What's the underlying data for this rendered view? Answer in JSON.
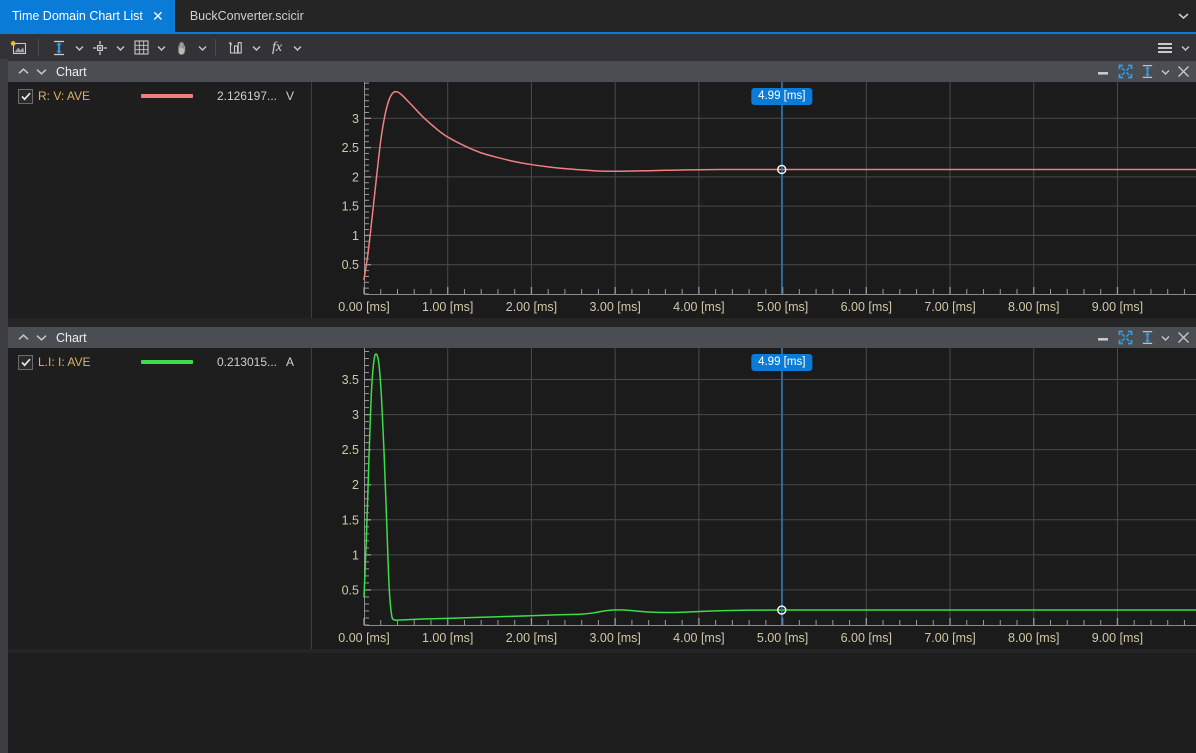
{
  "window": {
    "tabs": [
      {
        "label": "Time Domain Chart List",
        "active": true,
        "closable": true
      },
      {
        "label": "BuckConverter.scicir",
        "active": false,
        "closable": false
      }
    ],
    "tab_overflow_icon": "chevron-down-icon"
  },
  "toolbar": {
    "groups": [
      {
        "items": [
          {
            "icon": "new-chart-icon",
            "caret": false
          }
        ]
      },
      {
        "items": [
          {
            "icon": "vertical-zoom-icon",
            "caret": true
          },
          {
            "icon": "crosshair-cursor-icon",
            "caret": true
          },
          {
            "icon": "grid-icon",
            "caret": true
          },
          {
            "icon": "pan-hand-icon",
            "caret": true
          }
        ]
      },
      {
        "items": [
          {
            "icon": "bar-chart-icon",
            "caret": true
          },
          {
            "icon": "fx-function-icon",
            "caret": true,
            "label": "fx"
          }
        ]
      }
    ],
    "menu_icon": "hamburger-menu-icon",
    "menu_caret_icon": "chevron-down-icon"
  },
  "panels": [
    {
      "title": "Chart",
      "controls": {
        "collapse_up_icon": "chevron-up-icon",
        "collapse_down_icon": "chevron-down-icon",
        "minimize_icon": "minimize-icon",
        "maximize_icon": "maximize-icon",
        "fit_vertical_icon": "fit-vertical-icon",
        "fit_caret_icon": "chevron-down-icon",
        "close_icon": "close-icon"
      },
      "legend": [
        {
          "checked": true,
          "name": "R: V: AVE",
          "color": "#f08080",
          "value": "2.126197...",
          "unit": "V"
        }
      ],
      "cursor": {
        "label": "4.99 [ms]",
        "x_value": 4.99,
        "y_value": 2.126197
      }
    },
    {
      "title": "Chart",
      "controls": {
        "collapse_up_icon": "chevron-up-icon",
        "collapse_down_icon": "chevron-down-icon",
        "minimize_icon": "minimize-icon",
        "maximize_icon": "maximize-icon",
        "fit_vertical_icon": "fit-vertical-icon",
        "fit_caret_icon": "chevron-down-icon",
        "close_icon": "close-icon"
      },
      "legend": [
        {
          "checked": true,
          "name": "L.I: I: AVE",
          "color": "#3ddc4a",
          "value": "0.213015...",
          "unit": "A"
        }
      ],
      "cursor": {
        "label": "4.99 [ms]",
        "x_value": 4.99,
        "y_value": 0.213015
      }
    }
  ],
  "colors": {
    "accent": "#0a7bd6",
    "panel_header": "#4a4d52",
    "plot_background": "#1b1b1b",
    "grid": "#4a4a4a",
    "tick_label": "#d0c8a8",
    "series_1": "#f08080",
    "series_2": "#3ddc4a"
  },
  "chart_data": [
    {
      "type": "line",
      "title": "Chart",
      "xlabel": "",
      "ylabel": "",
      "grid": true,
      "legend_position": "left-pane",
      "xlim": [
        0.0,
        9.95
      ],
      "ylim": [
        0.0,
        3.62
      ],
      "xticks": [
        0.0,
        1.0,
        2.0,
        3.0,
        4.0,
        5.0,
        6.0,
        7.0,
        8.0,
        9.0
      ],
      "xticklabels": [
        "0.00 [ms]",
        "1.00 [ms]",
        "2.00 [ms]",
        "3.00 [ms]",
        "4.00 [ms]",
        "5.00 [ms]",
        "6.00 [ms]",
        "7.00 [ms]",
        "8.00 [ms]",
        "9.00 [ms]"
      ],
      "yticks": [
        0.5,
        1.0,
        1.5,
        2.0,
        2.5,
        3.0
      ],
      "yticklabels": [
        "0.5",
        "1",
        "1.5",
        "2",
        "2.5",
        "3"
      ],
      "series": [
        {
          "name": "R: V: AVE",
          "color": "#f08080",
          "unit": "V",
          "x": [
            0.0,
            0.05,
            0.1,
            0.15,
            0.2,
            0.25,
            0.3,
            0.35,
            0.4,
            0.45,
            0.5,
            0.6,
            0.7,
            0.8,
            0.9,
            1.0,
            1.2,
            1.4,
            1.6,
            1.8,
            2.0,
            2.2,
            2.4,
            2.6,
            2.8,
            3.0,
            3.2,
            3.4,
            3.6,
            3.8,
            4.0,
            4.4,
            4.8,
            5.2,
            5.6,
            6.0,
            7.0,
            8.0,
            9.0,
            9.95
          ],
          "y": [
            0.25,
            0.72,
            1.35,
            2.0,
            2.62,
            3.05,
            3.32,
            3.44,
            3.45,
            3.4,
            3.33,
            3.18,
            3.03,
            2.9,
            2.78,
            2.68,
            2.53,
            2.41,
            2.33,
            2.26,
            2.21,
            2.17,
            2.14,
            2.12,
            2.1,
            2.095,
            2.1,
            2.105,
            2.112,
            2.118,
            2.122,
            2.126,
            2.127,
            2.126,
            2.126,
            2.126,
            2.126,
            2.126,
            2.126,
            2.126
          ]
        }
      ]
    },
    {
      "type": "line",
      "title": "Chart",
      "xlabel": "",
      "ylabel": "",
      "grid": true,
      "legend_position": "left-pane",
      "xlim": [
        0.0,
        9.95
      ],
      "ylim": [
        0.0,
        3.95
      ],
      "xticks": [
        0.0,
        1.0,
        2.0,
        3.0,
        4.0,
        5.0,
        6.0,
        7.0,
        8.0,
        9.0
      ],
      "xticklabels": [
        "0.00 [ms]",
        "1.00 [ms]",
        "2.00 [ms]",
        "3.00 [ms]",
        "4.00 [ms]",
        "5.00 [ms]",
        "6.00 [ms]",
        "7.00 [ms]",
        "8.00 [ms]",
        "9.00 [ms]"
      ],
      "yticks": [
        0.5,
        1.0,
        1.5,
        2.0,
        2.5,
        3.0,
        3.5
      ],
      "yticklabels": [
        "0.5",
        "1",
        "1.5",
        "2",
        "2.5",
        "3",
        "3.5"
      ],
      "series": [
        {
          "name": "L.I: I: AVE",
          "color": "#3ddc4a",
          "unit": "A",
          "x": [
            0.0,
            0.03,
            0.06,
            0.09,
            0.12,
            0.15,
            0.18,
            0.21,
            0.24,
            0.27,
            0.3,
            0.33,
            0.36,
            0.4,
            0.5,
            0.7,
            1.0,
            1.4,
            1.8,
            2.2,
            2.4,
            2.6,
            2.75,
            2.9,
            3.05,
            3.2,
            3.4,
            3.6,
            3.8,
            4.0,
            4.3,
            4.6,
            5.0,
            5.5,
            6.0,
            7.0,
            8.0,
            9.0,
            9.95
          ],
          "y": [
            0.4,
            1.3,
            2.4,
            3.35,
            3.78,
            3.86,
            3.7,
            3.22,
            2.45,
            1.5,
            0.55,
            0.14,
            0.075,
            0.07,
            0.075,
            0.085,
            0.095,
            0.11,
            0.125,
            0.14,
            0.148,
            0.155,
            0.175,
            0.205,
            0.215,
            0.205,
            0.185,
            0.178,
            0.182,
            0.192,
            0.205,
            0.212,
            0.213,
            0.213,
            0.213,
            0.213,
            0.213,
            0.213,
            0.213
          ]
        }
      ]
    }
  ]
}
